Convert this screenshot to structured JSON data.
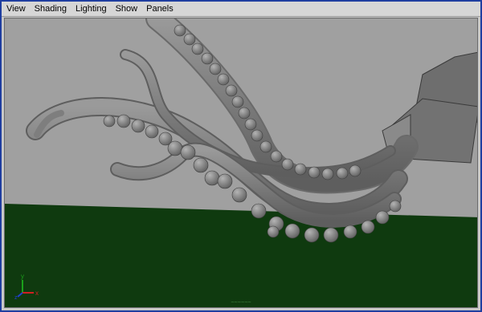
{
  "menubar": {
    "items": [
      {
        "label": "View"
      },
      {
        "label": "Shading"
      },
      {
        "label": "Lighting"
      },
      {
        "label": "Show"
      },
      {
        "label": "Panels"
      }
    ]
  },
  "viewport": {
    "background_color": "#a0a0a0",
    "ground_color": "#0f3a0f",
    "model_color": "#7c7c7c",
    "axis_labels": {
      "y": "y",
      "x": "x",
      "z": "z"
    },
    "status_text": "~~~~~~"
  },
  "colors": {
    "window_border": "#1f3ea0",
    "menubar_bg": "#d6d6d6",
    "axis_y": "#1aa01a",
    "axis_x": "#d02020",
    "axis_z": "#2040d0"
  }
}
